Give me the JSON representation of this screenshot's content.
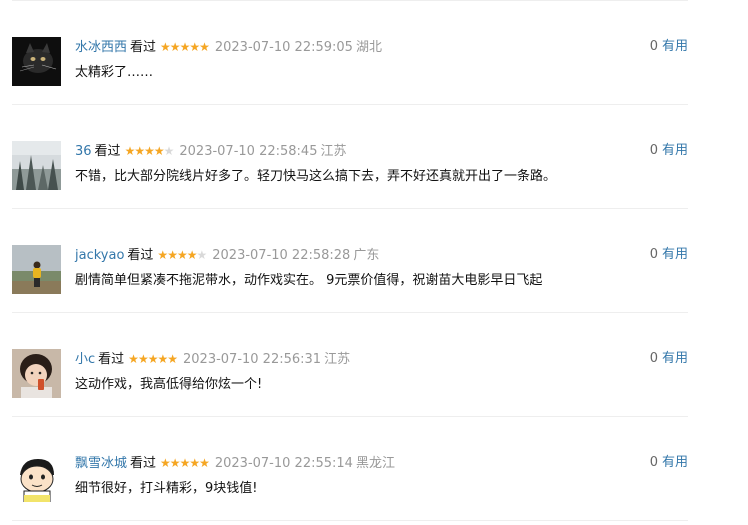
{
  "comments": [
    {
      "user": "水冰西西",
      "status": "看过",
      "rating": 5,
      "time": "2023-07-10 22:59:05",
      "region": "湖北",
      "content": "太精彩了……",
      "votes": "0",
      "useful_label": "有用",
      "avatar": "cat-photo"
    },
    {
      "user": "36",
      "status": "看过",
      "rating": 4,
      "time": "2023-07-10 22:58:45",
      "region": "江苏",
      "content": "不错，比大部分院线片好多了。轻刀快马这么搞下去，弄不好还真就开出了一条路。",
      "votes": "0",
      "useful_label": "有用",
      "avatar": "misty-forest"
    },
    {
      "user": "jackyao",
      "status": "看过",
      "rating": 4,
      "time": "2023-07-10 22:58:28",
      "region": "广东",
      "content": "剧情简单但紧凑不拖泥带水，动作戏实在。 9元票价值得，祝谢苗大电影早日飞起",
      "votes": "0",
      "useful_label": "有用",
      "avatar": "person-outdoors"
    },
    {
      "user": "小c",
      "status": "看过",
      "rating": 5,
      "time": "2023-07-10 22:56:31",
      "region": "江苏",
      "content": "这动作戏，我高低得给你炫一个!",
      "votes": "0",
      "useful_label": "有用",
      "avatar": "child-drinking"
    },
    {
      "user": "飘雪冰城",
      "status": "看过",
      "rating": 5,
      "time": "2023-07-10 22:55:14",
      "region": "黑龙江",
      "content": "细节很好，打斗精彩，9块钱值!",
      "votes": "0",
      "useful_label": "有用",
      "avatar": "cartoon-boy"
    }
  ],
  "colors": {
    "link": "#3377aa",
    "star": "#f5a623",
    "star_empty": "#d9d9d9",
    "meta": "#999999",
    "divider": "#eeeeee"
  }
}
